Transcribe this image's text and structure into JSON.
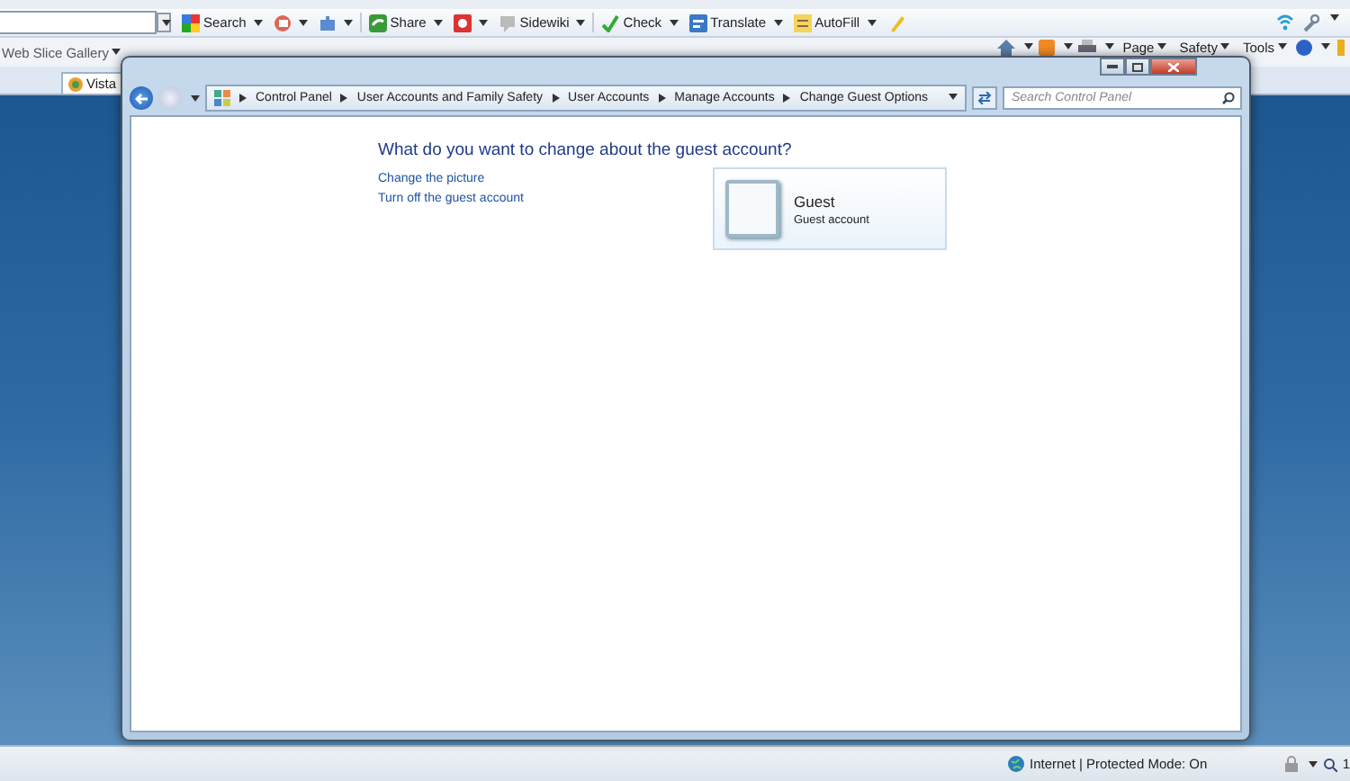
{
  "browser": {
    "toolbar": [
      {
        "label": "Search",
        "dropdown": true
      },
      {
        "dropdown": true
      },
      {
        "dropdown": true
      },
      {
        "label": "Share",
        "dropdown": true
      },
      {
        "dropdown": true
      },
      {
        "label": "Sidewiki",
        "dropdown": true
      },
      {
        "label": "Check",
        "dropdown": true
      },
      {
        "label": "Translate",
        "dropdown": true
      },
      {
        "label": "AutoFill",
        "dropdown": true
      },
      {
        "dropdown": false
      }
    ],
    "favorites": [
      {
        "label": "Web Slice Gallery",
        "dropdown": true
      }
    ],
    "command_bar": [
      {
        "label": "Page",
        "dropdown": true
      },
      {
        "label": "Safety",
        "dropdown": true
      },
      {
        "label": "Tools",
        "dropdown": true
      }
    ],
    "tabs": [
      {
        "label": "Vista",
        "selected": true
      }
    ],
    "status_bar": {
      "zone": "Internet | Protected Mode: On",
      "zoom": "1"
    }
  },
  "window": {
    "breadcrumb": [
      "Control Panel",
      "User Accounts and Family Safety",
      "User Accounts",
      "Manage Accounts",
      "Change Guest Options"
    ],
    "search": {
      "placeholder": "Search Control Panel"
    },
    "heading": "What do you want to change about the guest account?",
    "links": [
      "Change the picture",
      "Turn off the guest account"
    ],
    "account": {
      "name": "Guest",
      "type": "Guest account"
    }
  }
}
